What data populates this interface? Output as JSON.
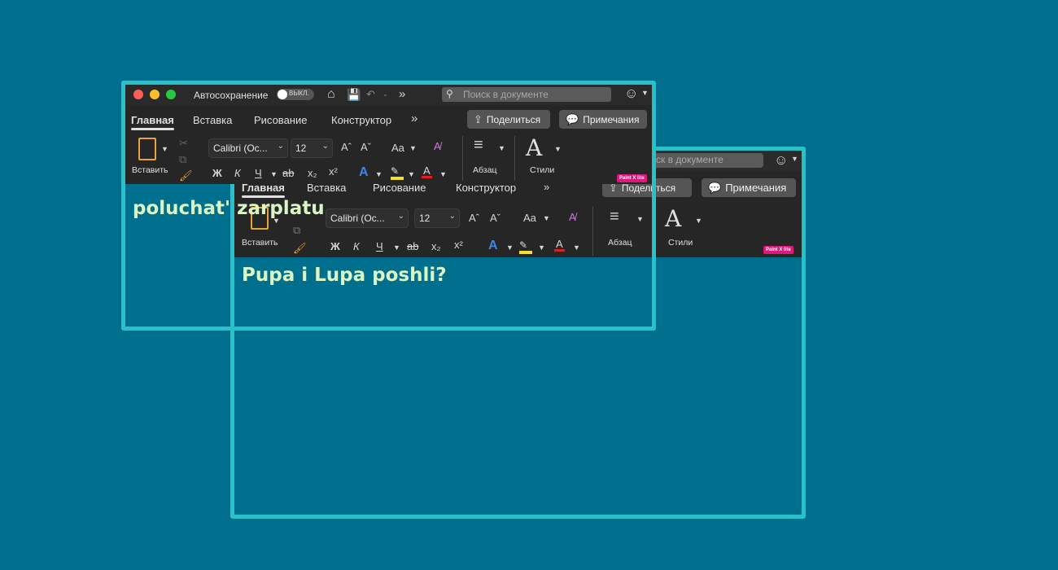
{
  "window1": {
    "autosave_label": "Автосохранение",
    "autosave_state": "ВЫКЛ.",
    "search_placeholder": "Поиск в документе",
    "tabs": [
      "Главная",
      "Вставка",
      "Рисование",
      "Конструктор"
    ],
    "share_label": "Поделиться",
    "comments_label": "Примечания",
    "paste_label": "Вставить",
    "font_name": "Calibri (Ос...",
    "font_size": "12",
    "paragraph_label": "Абзац",
    "styles_label": "Стили",
    "badge": "Paint X lite",
    "document_text": "poluchat' zarplatu"
  },
  "window2": {
    "search_placeholder": "Поиск в документе",
    "tabs": [
      "Главная",
      "Вставка",
      "Рисование",
      "Конструктор"
    ],
    "share_label": "Поделиться",
    "comments_label": "Примечания",
    "paste_label": "Вставить",
    "font_name": "Calibri (Ос...",
    "font_size": "12",
    "paragraph_label": "Абзац",
    "styles_label": "Стили",
    "badge": "Paint X lite",
    "document_text": "Pupa i Lupa poshli?"
  },
  "format_glyphs": {
    "bold": "Ж",
    "italic": "К",
    "underline": "Ч",
    "strike": "ab",
    "subscript": "x₂",
    "superscript": "x²",
    "case": "Aa",
    "grow": "Aˆ",
    "shrink": "Aˇ",
    "text_effect": "A",
    "font_color": "A"
  },
  "colors": {
    "background": "#006f8e",
    "window_border": "#26c1c9",
    "ribbon": "#262626",
    "doc_text": "#d9f5c4",
    "highlight": "#f5e12b",
    "font_color_bar": "#e02020",
    "badge": "#e0177a"
  }
}
